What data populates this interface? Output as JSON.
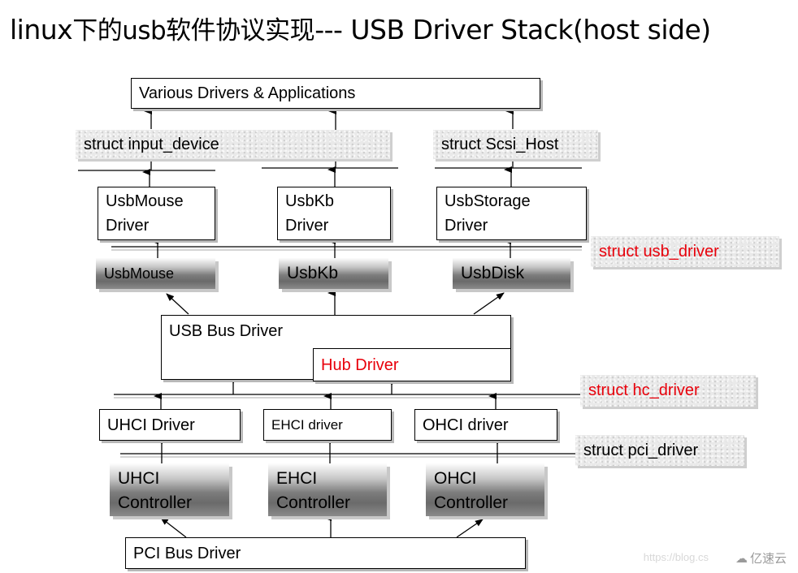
{
  "title": {
    "prefix": "linux",
    "chinese": "下的usb软件协议实现",
    "suffix": "--- USB Driver Stack(host side)"
  },
  "top_box": {
    "label": "Various Drivers & Applications"
  },
  "structs": {
    "input_device": "struct input_device",
    "scsi_host": "struct Scsi_Host",
    "usb_driver": "struct usb_driver",
    "hc_driver": "struct hc_driver",
    "pci_driver": "struct pci_driver"
  },
  "class_drivers": [
    {
      "line1": "UsbMouse",
      "line2": "Driver"
    },
    {
      "line1": "UsbKb",
      "line2": "Driver"
    },
    {
      "line1": "UsbStorage",
      "line2": "Driver"
    }
  ],
  "devices": [
    "UsbMouse",
    "UsbKb",
    "UsbDisk"
  ],
  "bus": {
    "usb_bus_driver": "USB Bus Driver",
    "hub_driver": "Hub Driver"
  },
  "hc_drivers": [
    "UHCI Driver",
    "EHCI driver",
    "OHCI driver"
  ],
  "controllers": [
    {
      "line1": "UHCI",
      "line2": "Controller"
    },
    {
      "line1": "EHCI",
      "line2": "Controller"
    },
    {
      "line1": "OHCI",
      "line2": "Controller"
    }
  ],
  "pci_bus": {
    "label": "PCI Bus Driver"
  },
  "watermark": {
    "url_text": "https://blog.cs",
    "brand": "亿速云",
    "brand_icon": "cloud-logo-icon"
  },
  "colors": {
    "highlight": "#e8000b",
    "shadow": "#b8b8b8",
    "label_bg": "#e9e9e9"
  }
}
